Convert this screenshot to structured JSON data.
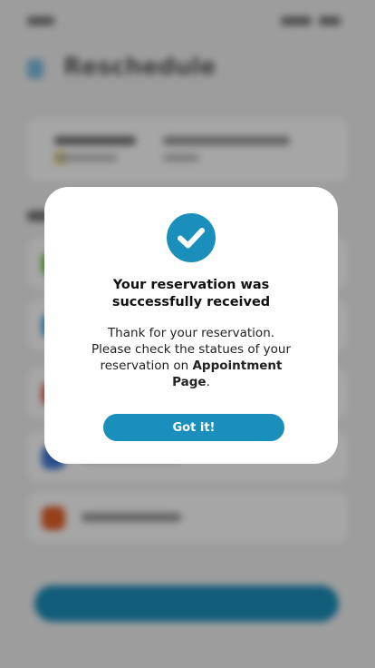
{
  "background": {
    "app_title": "Reschedule",
    "methods": [
      {
        "icon": "payment-method-icon",
        "color": "#6cc04a"
      },
      {
        "icon": "payment-method-icon",
        "color": "#3fa0e6"
      },
      {
        "icon": "payment-method-icon",
        "color": "#e05a4a"
      },
      {
        "icon": "payment-method-icon",
        "color": "#3f7ad6"
      },
      {
        "icon": "mastercard-icon",
        "color": "#e8622a"
      }
    ]
  },
  "dialog": {
    "title_line1": "Your reservation was",
    "title_line2": "successfully received",
    "body_line1": "Thank for your reservation.",
    "body_line2": "Please check the statues of your",
    "body_line3_pre": "reservation on ",
    "body_bold1": "Appointment",
    "body_bold2": "Page",
    "body_post": ".",
    "button_label": "Got it!",
    "accent": "#1b8fbc",
    "check_icon": "check-circle-icon"
  }
}
